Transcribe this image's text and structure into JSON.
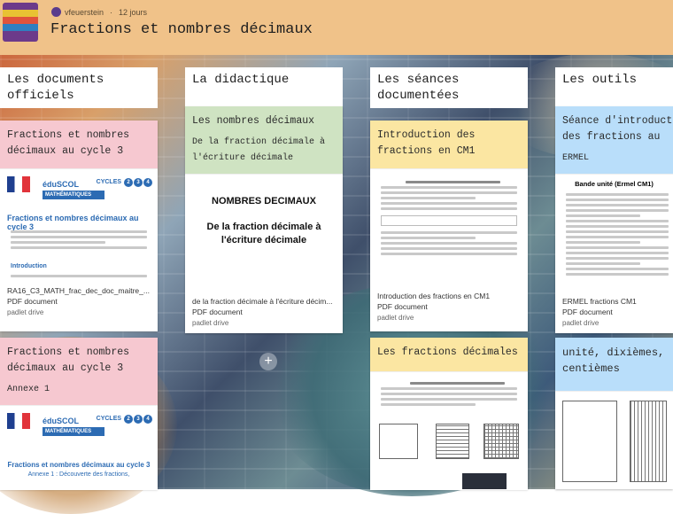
{
  "header": {
    "author": "vfeuerstein",
    "separator": "·",
    "age": "12 jours",
    "title": "Fractions et nombres décimaux"
  },
  "columns": [
    {
      "title": "Les documents officiels",
      "cards": [
        {
          "heading": "Fractions et nombres décimaux au cycle 3",
          "subheading": "",
          "color": "#f6c8d0",
          "file_name": "RA16_C3_MATH_frac_dec_doc_maitre_...",
          "file_type": "PDF document",
          "source": "padlet drive",
          "thumb": {
            "brand": "éduSCOL",
            "banner": "MATHÉMATIQUES",
            "cycles_label": "CYCLES",
            "cycles": [
              "2",
              "3",
              "4"
            ],
            "doc_title": "Fractions et nombres décimaux au cycle 3",
            "section": "Introduction"
          }
        },
        {
          "heading": "Fractions et nombres décimaux au cycle 3",
          "subheading": "Annexe 1",
          "color": "#f6c8d0",
          "thumb": {
            "brand": "éduSCOL",
            "banner": "MATHÉMATIQUES",
            "cycles_label": "CYCLES",
            "cycles": [
              "2",
              "3",
              "4"
            ],
            "doc_title": "Fractions et nombres décimaux au cycle 3",
            "doc_sub": "Annexe 1 : Découverte des fractions,"
          }
        }
      ]
    },
    {
      "title": "La didactique",
      "cards": [
        {
          "heading": "Les nombres décimaux",
          "subheading": "De la fraction décimale à l'écriture décimale",
          "color": "#cfe3c2",
          "file_name": "de la fraction décimale à l'écriture décim...",
          "file_type": "PDF document",
          "source": "padlet drive",
          "thumb": {
            "title": "NOMBRES DECIMAUX",
            "subtitle": "De la fraction décimale à l'écriture décimale"
          }
        }
      ]
    },
    {
      "title": "Les séances documentées",
      "cards": [
        {
          "heading": "Introduction des fractions en CM1",
          "color": "#fbe6a2",
          "file_name": "Introduction des fractions en CM1",
          "file_type": "PDF document",
          "source": "padlet drive"
        },
        {
          "heading": "Les fractions décimales",
          "color": "#fbe6a2"
        }
      ]
    },
    {
      "title": "Les outils",
      "cards": [
        {
          "heading": "Séance d'introduction des fractions au",
          "subheading": "ERMEL",
          "color": "#b9defa",
          "file_name": "ERMEL fractions CM1",
          "file_type": "PDF document",
          "source": "padlet drive",
          "thumb": {
            "title": "Bande unité (Ermel CM1)"
          }
        },
        {
          "heading": "unité, dixièmes, centièmes",
          "color": "#b9defa"
        }
      ]
    }
  ],
  "add_button": "+"
}
